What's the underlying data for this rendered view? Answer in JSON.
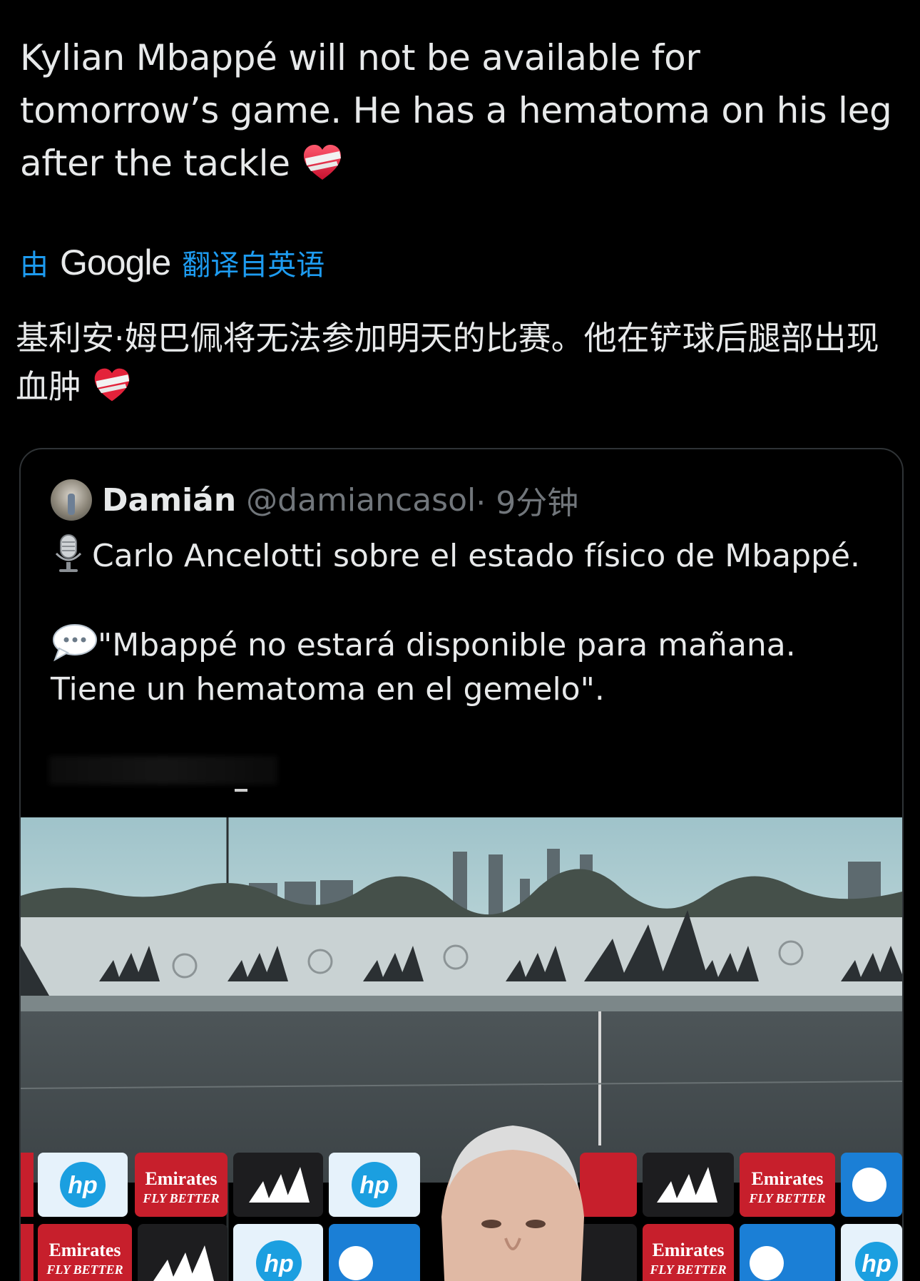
{
  "tweet": {
    "text": "Kylian Mbappé will not be available for tomorrow’s game. He has a hematoma on his leg after the tackle",
    "emoji": "mending-heart"
  },
  "translation": {
    "by": "由",
    "provider": "Google",
    "from_label": "翻译自英语",
    "text": "基利安·姆巴佩将无法参加明天的比赛。他在铲球后腿部出现血肿"
  },
  "quoted_tweet": {
    "author_name": "Damián",
    "author_handle": "@damiancasol",
    "time": "· 9分钟",
    "line1": "Carlo Ancelotti sobre el estado físico de Mbappé.",
    "line2": "\"Mbappé no estará disponible para mañana. Tiene un hematoma en el gemelo\".",
    "emoji_line1": "microphone",
    "emoji_line2": "speech-balloon",
    "media": {
      "board_sponsors": [
        "hp",
        "Emirates",
        "FLY BETTER"
      ]
    }
  },
  "colors": {
    "background": "#000000",
    "text": "#e7e9ea",
    "link": "#1d9bf0",
    "muted": "#71767b",
    "border": "#2f3336"
  }
}
